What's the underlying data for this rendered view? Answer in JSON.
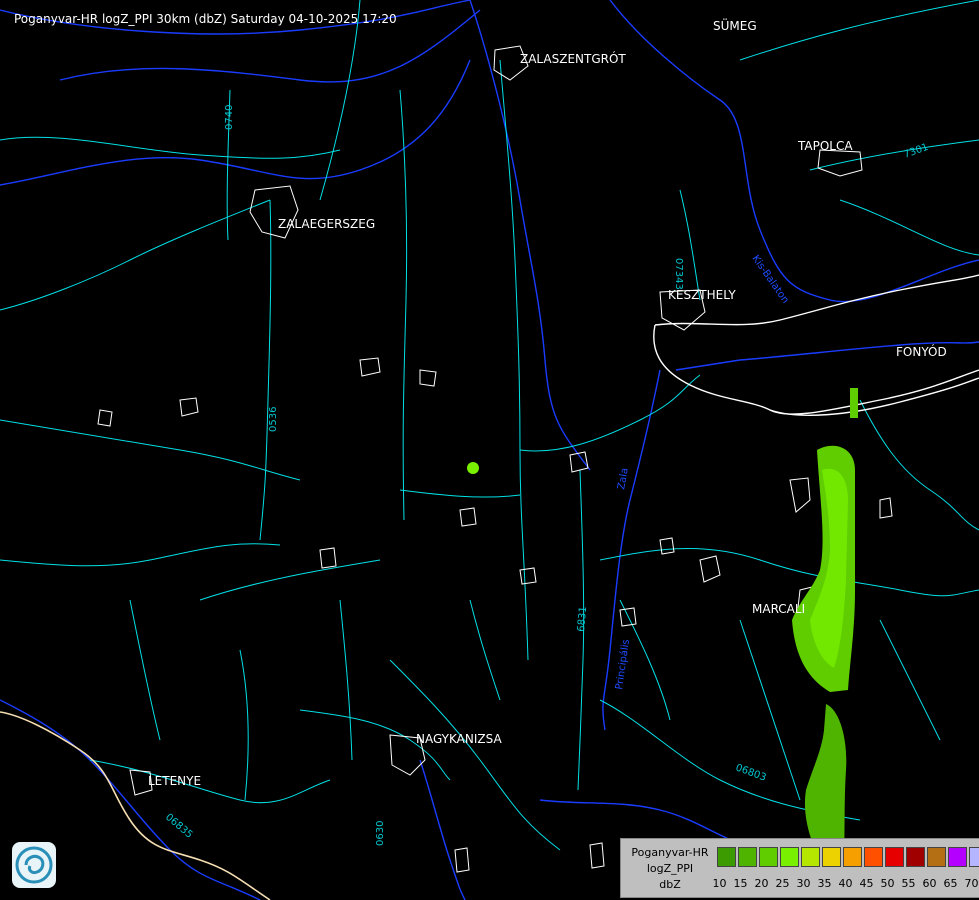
{
  "title": "Poganyvar-HR logZ_PPI 30km (dbZ) Saturday 04-10-2025 17:20",
  "cities": [
    {
      "name": "SÜMEG"
    },
    {
      "name": "ZALASZENTGRÓT"
    },
    {
      "name": "TAPOLCA"
    },
    {
      "name": "ZALAEGERSZEG"
    },
    {
      "name": "KESZTHELY"
    },
    {
      "name": "FONYÓD"
    },
    {
      "name": "MARCALI"
    },
    {
      "name": "NAGYKANIZSA"
    },
    {
      "name": "LETENYE"
    }
  ],
  "road_labels": [
    "0740",
    "07343",
    "7301",
    "0536",
    "6831",
    "06803",
    "06835",
    "0630"
  ],
  "river_labels": [
    "Zala",
    "Principális",
    "Kis-Balaton"
  ],
  "legend": {
    "line1": "Poganyvar-HR",
    "line2": "logZ_PPI",
    "line3": "dbZ",
    "ticks": [
      "10",
      "15",
      "20",
      "25",
      "30",
      "35",
      "40",
      "45",
      "50",
      "55",
      "60",
      "65",
      "70"
    ],
    "colors": [
      "#3c9b00",
      "#4fb400",
      "#5fcd00",
      "#78f000",
      "#b4e600",
      "#ebd200",
      "#f5a000",
      "#ff5000",
      "#e60000",
      "#a00000",
      "#b46e14",
      "#b400ff",
      "#b4b4ff"
    ]
  },
  "colors": {
    "background": "#000000",
    "roads": "#00ffff",
    "rivers": "#0030ff",
    "settlements": "#ffffff",
    "echo_light": "#78f000",
    "echo_mid": "#5fcd00",
    "echo_dark": "#4fb400",
    "border": "#f5deb3"
  },
  "logo": {
    "icon": "radar-logo-icon"
  }
}
